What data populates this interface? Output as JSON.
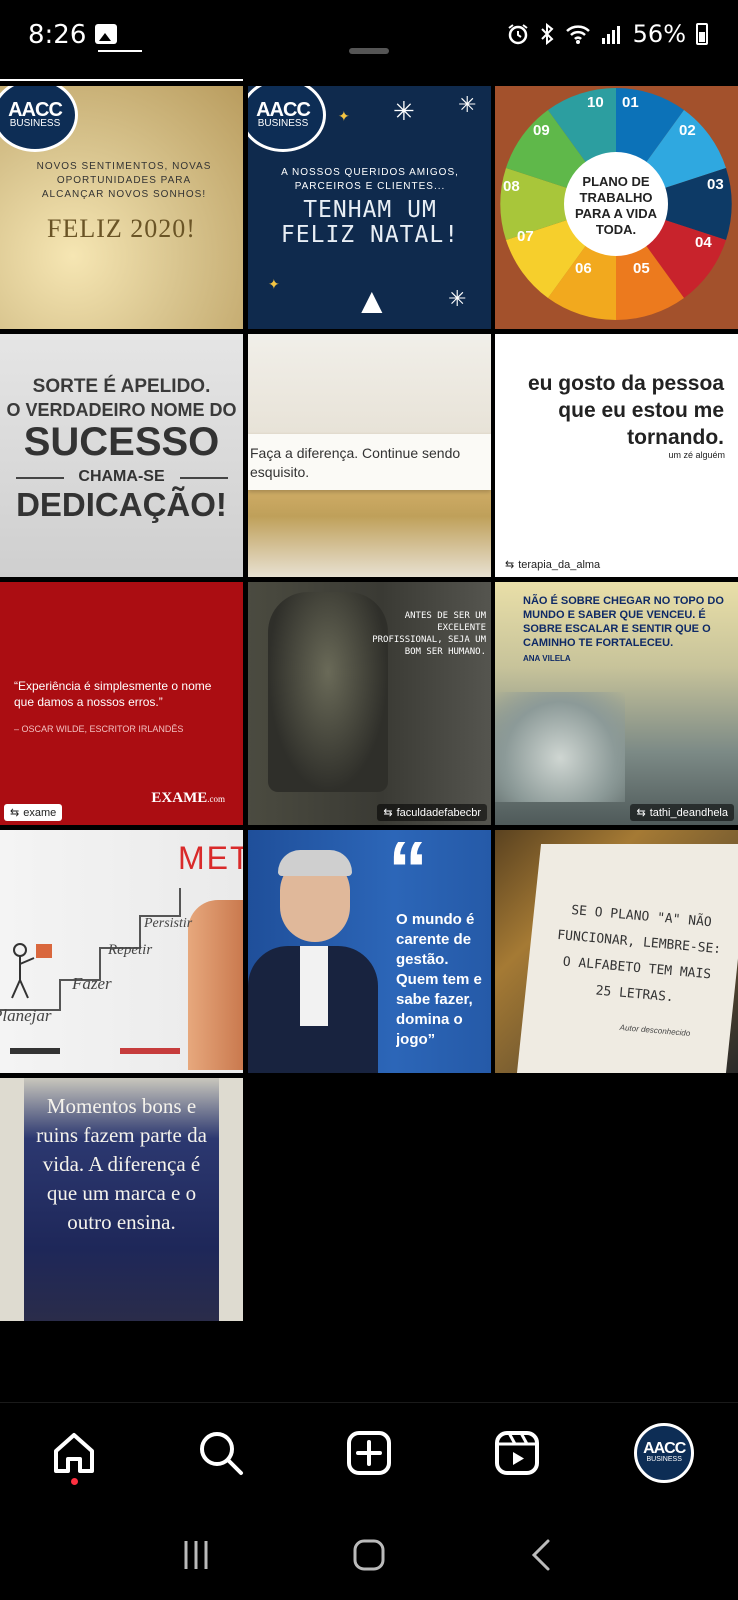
{
  "status_bar": {
    "time": "8:26",
    "battery": "56%",
    "icons": [
      "gallery-icon",
      "alarm-icon",
      "bluetooth-icon",
      "wifi-icon",
      "signal-icon",
      "battery-icon"
    ]
  },
  "posts": [
    {
      "logo_line1": "AACC",
      "logo_line2": "BUSINESS",
      "text": "NOVOS SENTIMENTOS, NOVAS OPORTUNIDADES PARA ALCANÇAR NOVOS SONHOS!",
      "headline": "FELIZ 2020!"
    },
    {
      "logo_line1": "AACC",
      "logo_line2": "BUSINESS",
      "text": "A NOSSOS QUERIDOS AMIGOS, PARCEIROS E CLIENTES...",
      "headline": "TENHAM UM FELIZ NATAL!"
    },
    {
      "center_text": "PLANO DE TRABALHO PARA A VIDA TODA.",
      "numbers": [
        "01",
        "02",
        "03",
        "04",
        "05",
        "06",
        "07",
        "08",
        "09",
        "10"
      ]
    },
    {
      "line1": "SORTE É APELIDO.",
      "line2": "O VERDADEIRO NOME DO",
      "line3": "SUCESSO",
      "line4": "CHAMA-SE",
      "line5": "DEDICAÇÃO!"
    },
    {
      "text": "Faça a diferença. Continue sendo esquisito."
    },
    {
      "text": "eu gosto da pessoa que eu estou me tornando.",
      "signature": "um zé alguém",
      "repost_user": "terapia_da_alma"
    },
    {
      "quote": "“Experiência é simplesmente o nome que damos a nossos erros.”",
      "author": "– OSCAR WILDE, ESCRITOR IRLANDÊS",
      "brand": "EXAME",
      "brand_suffix": ".com",
      "repost_user": "exame"
    },
    {
      "text": "ANTES DE SER UM EXCELENTE PROFISSIONAL, SEJA UM BOM SER HUMANO.",
      "repost_user": "faculdadefabecbr"
    },
    {
      "text": "NÃO É SOBRE CHEGAR NO TOPO DO MUNDO E SABER QUE VENCEU. É SOBRE ESCALAR E SENTIR QUE O CAMINHO TE FORTALECEU.",
      "author": "ANA VILELA",
      "repost_user": "tathi_deandhela"
    },
    {
      "meta": "MET",
      "steps": [
        "Planejar",
        "Fazer",
        "Repetir",
        "Persistir"
      ]
    },
    {
      "quote_mark": "“",
      "text": "O mundo é carente de gestão. Quem tem e sabe fazer, domina o jogo”"
    },
    {
      "text": "SE O PLANO \"A\" NÃO FUNCIONAR, LEMBRE-SE: O ALFABETO TEM MAIS 25 LETRAS.",
      "author": "Autor desconhecido"
    },
    {
      "text": "Momentos bons e ruins fazem parte da vida. A diferença é que um marca e o outro ensina."
    }
  ],
  "bottom_nav": {
    "items": [
      "home-icon",
      "search-icon",
      "create-icon",
      "reels-icon",
      "profile-avatar"
    ],
    "avatar_line1": "AACC",
    "avatar_line2": "BUSINESS"
  },
  "system_nav": [
    "recent-apps",
    "home",
    "back"
  ]
}
